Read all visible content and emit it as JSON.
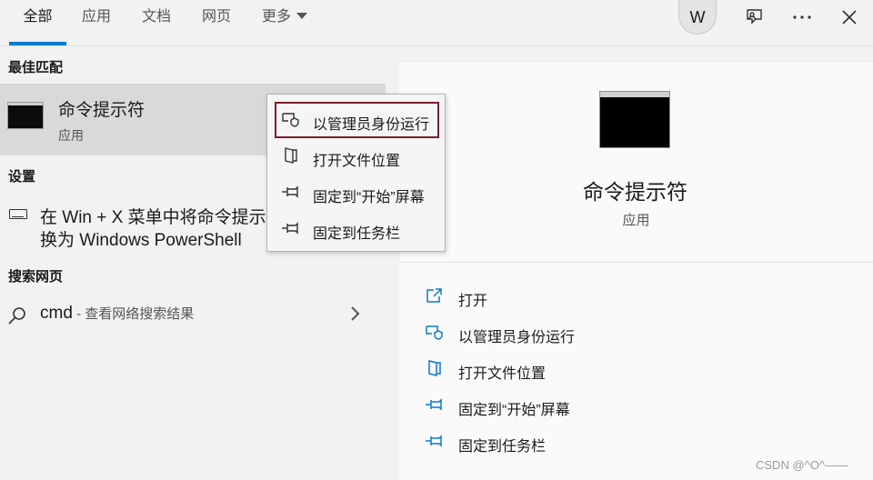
{
  "tabs": [
    {
      "label": "全部"
    },
    {
      "label": "应用"
    },
    {
      "label": "文档"
    },
    {
      "label": "网页"
    },
    {
      "label": "更多"
    }
  ],
  "header": {
    "avatar_letter": "W",
    "feedback_icon": "feedback-icon",
    "more_icon": "ellipsis-icon",
    "close_icon": "close-icon"
  },
  "best_match": {
    "heading": "最佳匹配",
    "title": "命令提示符",
    "subtitle": "应用"
  },
  "settings": {
    "heading": "设置",
    "line1": "在 Win + X 菜单中将命令提示",
    "line2": "换为 Windows PowerShell"
  },
  "web": {
    "heading": "搜索网页",
    "query": "cmd",
    "hint": " - 查看网络搜索结果"
  },
  "context_menu": [
    {
      "label": "以管理员身份运行",
      "icon": "shield-icon"
    },
    {
      "label": "打开文件位置",
      "icon": "file-location-icon"
    },
    {
      "label": "固定到“开始”屏幕",
      "icon": "pin-icon"
    },
    {
      "label": "固定到任务栏",
      "icon": "pin-icon"
    }
  ],
  "preview": {
    "title": "命令提示符",
    "subtitle": "应用",
    "actions": [
      {
        "label": "打开",
        "icon": "open-icon"
      },
      {
        "label": "以管理员身份运行",
        "icon": "shield-icon"
      },
      {
        "label": "打开文件位置",
        "icon": "file-location-icon"
      },
      {
        "label": "固定到“开始”屏幕",
        "icon": "pin-icon"
      },
      {
        "label": "固定到任务栏",
        "icon": "pin-icon"
      }
    ]
  },
  "watermark": "CSDN @^O^——",
  "colors": {
    "accent": "#0a7acc",
    "highlight_border": "#7a1f2b",
    "selection_bg": "#d9d9d9"
  }
}
